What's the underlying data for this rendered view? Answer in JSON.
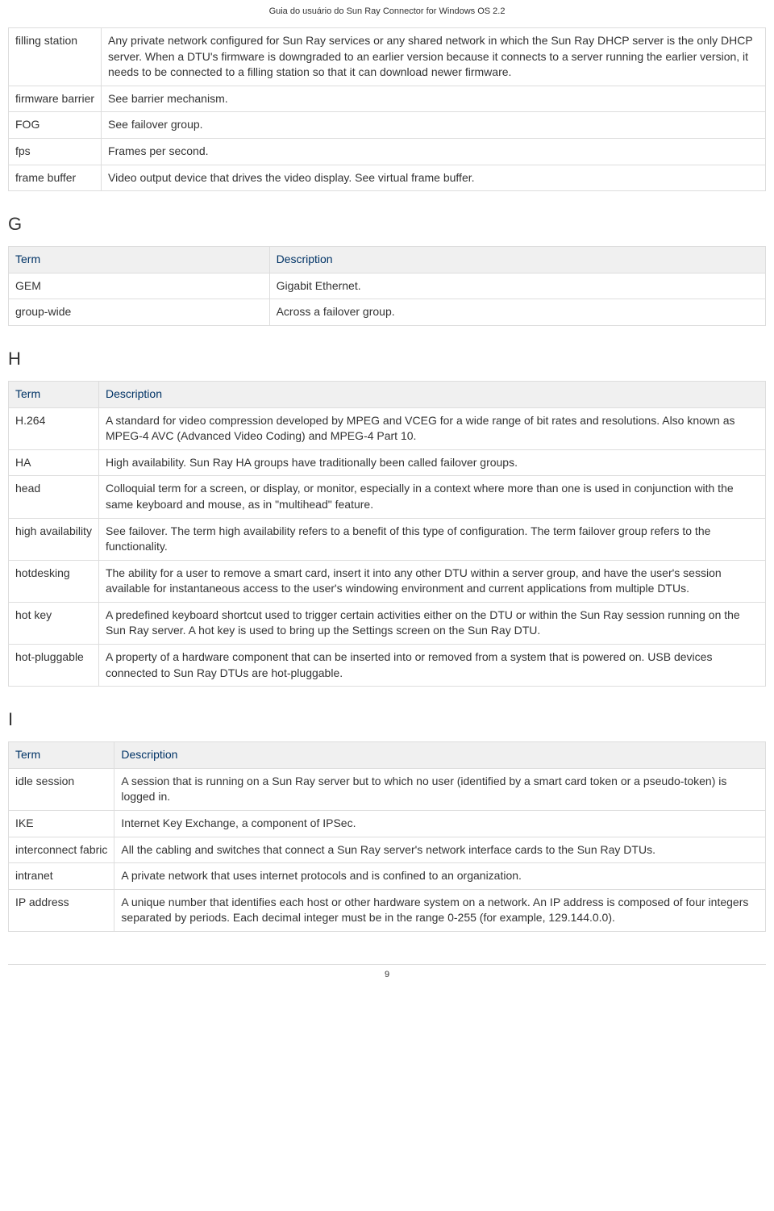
{
  "header": "Guia do usuário do Sun Ray Connector for Windows OS 2.2",
  "page_number": "9",
  "col": {
    "term": "Term",
    "desc": "Description"
  },
  "letters": {
    "g": "G",
    "h": "H",
    "i": "I"
  },
  "f": {
    "filling_station": {
      "t": "filling station",
      "d": "Any private network configured for Sun Ray services or any shared network in which the Sun Ray DHCP server is the only DHCP server. When a DTU's firmware is downgraded to an earlier version because it connects to a server running the earlier version, it needs to be connected to a filling station so that it can download newer firmware."
    },
    "firmware_barrier": {
      "t": "firmware barrier",
      "d": "See barrier mechanism."
    },
    "fog": {
      "t": "FOG",
      "d": "See failover group."
    },
    "fps": {
      "t": "fps",
      "d": "Frames per second."
    },
    "frame_buffer": {
      "t": "frame buffer",
      "d": "Video output device that drives the video display. See virtual frame buffer."
    }
  },
  "g": {
    "gem": {
      "t": "GEM",
      "d": "Gigabit Ethernet."
    },
    "group_wide": {
      "t": "group-wide",
      "d": "Across a failover group."
    }
  },
  "h": {
    "h264": {
      "t": "H.264",
      "d": "A standard for video compression developed by MPEG and VCEG for a wide range of bit rates and resolutions. Also known as MPEG-4 AVC (Advanced Video Coding) and MPEG-4 Part 10."
    },
    "ha": {
      "t": "HA",
      "d": "High availability. Sun Ray HA groups have traditionally been called failover groups."
    },
    "head": {
      "t": "head",
      "d": "Colloquial term for a screen, or display, or monitor, especially in a context where more than one is used in conjunction with the same keyboard and mouse, as in \"multihead\" feature."
    },
    "high_availability": {
      "t": "high availability",
      "d": "See failover. The term high availability refers to a benefit of this type of configuration. The term failover group refers to the functionality."
    },
    "hotdesking": {
      "t": "hotdesking",
      "d": "The ability for a user to remove a smart card, insert it into any other DTU within a server group, and have the user's session available for instantaneous access to the user's windowing environment and current applications from multiple DTUs."
    },
    "hot_key": {
      "t": "hot key",
      "d": "A predefined keyboard shortcut used to trigger certain activities either on the DTU or within the Sun Ray session running on the Sun Ray server. A hot key is used to bring up the Settings screen on the Sun Ray DTU."
    },
    "hot_pluggable": {
      "t": "hot-pluggable",
      "d": "A property of a hardware component that can be inserted into or removed from a system that is powered on. USB devices connected to Sun Ray DTUs are hot-pluggable."
    }
  },
  "i": {
    "idle_session": {
      "t": "idle session",
      "d": "A session that is running on a Sun Ray server but to which no user (identified by a smart card token or a pseudo-token) is logged in."
    },
    "ike": {
      "t": "IKE",
      "d": "Internet Key Exchange, a component of IPSec."
    },
    "interconnect_fabric": {
      "t": "interconnect fabric",
      "d": "All the cabling and switches that connect a Sun Ray server's network interface cards to the Sun Ray DTUs."
    },
    "intranet": {
      "t": "intranet",
      "d": "A private network that uses internet protocols and is confined to an organization."
    },
    "ip_address": {
      "t": "IP address",
      "d": "A unique number that identifies each host or other hardware system on a network. An IP address is composed of four integers separated by periods. Each decimal integer must be in the range 0-255 (for example, 129.144.0.0)."
    }
  }
}
